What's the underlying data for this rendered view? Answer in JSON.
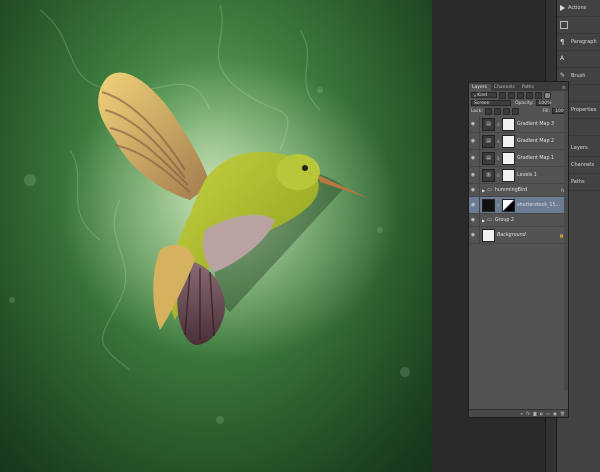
{
  "layers_panel": {
    "tabs": [
      "Layers",
      "Channels",
      "Paths"
    ],
    "filter": {
      "kind_label": "Kind"
    },
    "blend_mode": "Screen",
    "opacity_label": "Opacity:",
    "opacity_value": "100%",
    "lock_label": "Lock:",
    "fill_label": "Fill:",
    "fill_value": "100%",
    "layers": [
      {
        "name": "Gradient Map 3",
        "type": "adjustment"
      },
      {
        "name": "Gradient Map 2",
        "type": "adjustment"
      },
      {
        "name": "Gradient Map 1",
        "type": "adjustment"
      },
      {
        "name": "Levels 1",
        "type": "adjustment"
      },
      {
        "name": "hummingBird",
        "type": "group"
      },
      {
        "name": "shutterstock_15...",
        "type": "smart",
        "selected": true
      },
      {
        "name": "Group 2",
        "type": "group"
      },
      {
        "name": "Background",
        "type": "background"
      }
    ]
  },
  "mini_panel": {
    "items": [
      "Actions",
      "",
      "Paragraph",
      "",
      "Brush",
      "",
      "Properties",
      "",
      "Layers",
      "Channels",
      "Paths"
    ]
  }
}
